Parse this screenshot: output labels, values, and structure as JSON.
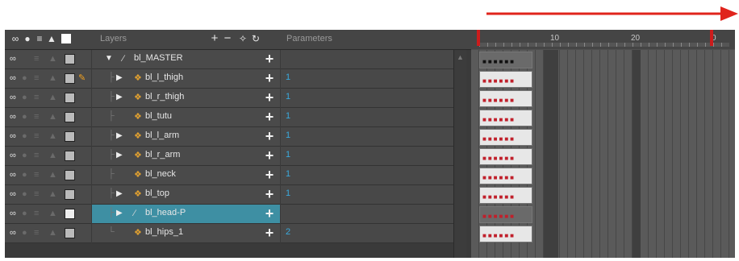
{
  "header": {
    "layers_label": "Layers",
    "parameters_label": "Parameters",
    "icons": [
      "onion-skin-icon",
      "visibility-icon",
      "layer-stack-icon",
      "lock-icon",
      "color-swatch-icon"
    ],
    "toolbar_icons": [
      "add-layer-icon",
      "remove-layer-icon",
      "add-peg-icon",
      "add-effect-icon"
    ]
  },
  "timeline": {
    "ticks": [
      "10",
      "20",
      "0"
    ],
    "accent": "#cc1c1c"
  },
  "layers": [
    {
      "name": "bl_MASTER",
      "param": "",
      "indent": 0,
      "expand": "down",
      "type": "peg",
      "selected": false
    },
    {
      "name": "bl_l_thigh",
      "param": "1",
      "indent": 1,
      "expand": "right",
      "type": "drawing",
      "selected": false
    },
    {
      "name": "bl_r_thigh",
      "param": "1",
      "indent": 1,
      "expand": "right",
      "type": "drawing",
      "selected": false
    },
    {
      "name": "bl_tutu",
      "param": "1",
      "indent": 1,
      "expand": "none",
      "type": "drawing",
      "selected": false
    },
    {
      "name": "bl_l_arm",
      "param": "1",
      "indent": 1,
      "expand": "right",
      "type": "drawing",
      "selected": false
    },
    {
      "name": "bl_r_arm",
      "param": "1",
      "indent": 1,
      "expand": "right",
      "type": "drawing",
      "selected": false
    },
    {
      "name": "bl_neck",
      "param": "1",
      "indent": 1,
      "expand": "none",
      "type": "drawing",
      "selected": false
    },
    {
      "name": "bl_top",
      "param": "1",
      "indent": 1,
      "expand": "right",
      "type": "drawing",
      "selected": false
    },
    {
      "name": "bl_head-P",
      "param": "",
      "indent": 1,
      "expand": "right",
      "type": "peg",
      "selected": true
    },
    {
      "name": "bl_hips_1",
      "param": "2",
      "indent": 1,
      "expand": "none",
      "type": "drawing",
      "selected": false
    }
  ]
}
